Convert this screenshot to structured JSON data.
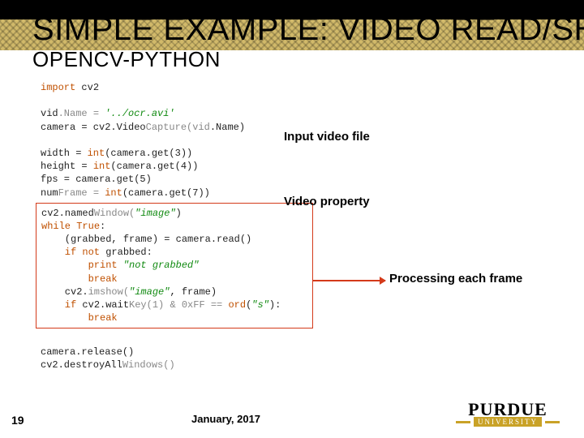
{
  "title": "SIMPLE EXAMPLE: VIDEO READ/SHOW",
  "subtitle": "OPENCV-PYTHON",
  "code": {
    "l1a": "import",
    "l1b": " cv2",
    "l2a": "vid",
    "l2b": ".Name = ",
    "l2c": "'../ocr.avi'",
    "l3a": "camera = cv2.Video",
    "l3b": "Capture(vid",
    "l3c": ".Name)",
    "l4a": "width = ",
    "l4b": "int",
    "l4c": "(camera.get(3))",
    "l5a": "height = ",
    "l5b": "int",
    "l5c": "(camera.get(4))",
    "l6": "fps = camera.get(5)",
    "l7a": "num",
    "l7b": "Frame = ",
    "l7c": "int",
    "l7d": "(camera.get(7))",
    "l8a": "cv2.named",
    "l8b": "Window(",
    "l8c": "\"image\"",
    "l8d": ")",
    "l9a": "while ",
    "l9b": "True",
    "l9c": ":",
    "l10": "    (grabbed, frame) = camera.read()",
    "l11a": "    if not ",
    "l11b": "grabbed",
    "l11c": ":",
    "l12a": "        print ",
    "l12b": "\"not grabbed\"",
    "l13": "        break",
    "l14a": "    cv2.",
    "l14b": "imshow(",
    "l14c": "\"image\"",
    "l14d": ", frame)",
    "l15a": "    if ",
    "l15b": "cv2.wait",
    "l15c": "Key(1) & 0xFF == ",
    "l15d": "ord",
    "l15e": "(",
    "l15f": "\"s\"",
    "l15g": "):",
    "l16": "        break",
    "l17": "camera.release()",
    "l18a": "cv2.destroyAll",
    "l18b": "Windows()"
  },
  "annot": {
    "input": "Input video file",
    "prop": "Video property",
    "proc": "Processing each frame"
  },
  "slide_number": "19",
  "date": "January, 2017",
  "logo": {
    "name": "PURDUE",
    "sub": "UNIVERSITY"
  }
}
